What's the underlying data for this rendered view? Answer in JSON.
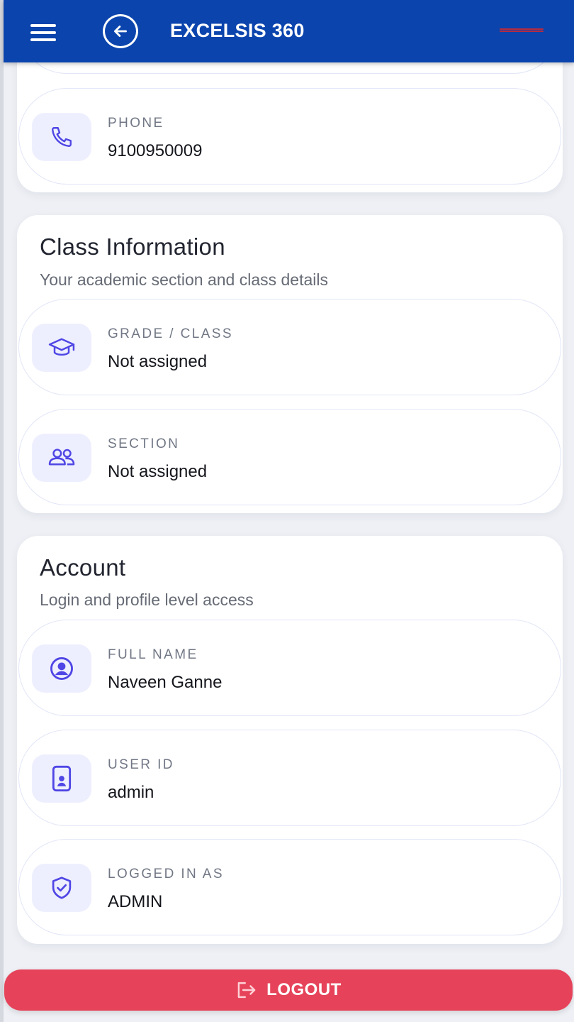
{
  "header": {
    "title": "EXCELSIS 360",
    "menu_icon": "hamburger-menu-icon",
    "back_icon": "arrow-left-circle-icon",
    "color": "#0b44ad"
  },
  "contact": {
    "phone": {
      "label": "PHONE",
      "value": "9100950009",
      "icon": "phone-icon"
    }
  },
  "class_info": {
    "title": "Class Information",
    "subtitle": "Your academic section and class details",
    "grade": {
      "label": "GRADE / CLASS",
      "value": "Not assigned",
      "icon": "graduation-cap-icon"
    },
    "section": {
      "label": "SECTION",
      "value": "Not assigned",
      "icon": "users-icon"
    }
  },
  "account": {
    "title": "Account",
    "subtitle": "Login and profile level access",
    "full_name": {
      "label": "FULL NAME",
      "value": "Naveen Ganne",
      "icon": "user-circle-icon"
    },
    "user_id": {
      "label": "USER ID",
      "value": "admin",
      "icon": "id-badge-icon"
    },
    "logged_in_as": {
      "label": "LOGGED IN AS",
      "value": "ADMIN",
      "icon": "shield-check-icon"
    }
  },
  "logout": {
    "label": "LOGOUT",
    "icon": "logout-icon",
    "color": "#e6435a"
  },
  "colors": {
    "accent": "#4f46e5",
    "icon_bg": "#eeeffe"
  }
}
